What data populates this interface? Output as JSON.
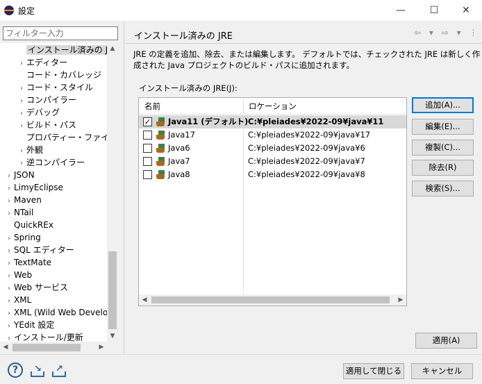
{
  "window": {
    "title": "設定",
    "minimize": "—",
    "maximize": "☐",
    "close": "✕"
  },
  "sidebar": {
    "filter_placeholder": "フィルター入力",
    "items": [
      {
        "label": "インストール済みの JRE",
        "expander": "",
        "selected": true
      },
      {
        "label": "エディター",
        "expander": "›"
      },
      {
        "label": "コード・カバレッジ",
        "expander": ""
      },
      {
        "label": "コード・スタイル",
        "expander": "›"
      },
      {
        "label": "コンパイラー",
        "expander": "›"
      },
      {
        "label": "デバッグ",
        "expander": "›"
      },
      {
        "label": "ビルド・パス",
        "expander": "›"
      },
      {
        "label": "プロパティー・ファイル・エデ",
        "expander": ""
      },
      {
        "label": "外観",
        "expander": "›"
      },
      {
        "label": "逆コンパイラー",
        "expander": "›"
      },
      {
        "label": "JSON",
        "expander": "›"
      },
      {
        "label": "LimyEclipse",
        "expander": "›"
      },
      {
        "label": "Maven",
        "expander": "›"
      },
      {
        "label": "NTail",
        "expander": "›"
      },
      {
        "label": "QuickREx",
        "expander": ""
      },
      {
        "label": "Spring",
        "expander": "›"
      },
      {
        "label": "SQL エディター",
        "expander": "›"
      },
      {
        "label": "TextMate",
        "expander": "›"
      },
      {
        "label": "Web",
        "expander": "›"
      },
      {
        "label": "Web サービス",
        "expander": "›"
      },
      {
        "label": "XML",
        "expander": "›"
      },
      {
        "label": "XML (Wild Web Develop",
        "expander": "›"
      },
      {
        "label": "YEdit 設定",
        "expander": "›"
      },
      {
        "label": "インストール/更新",
        "expander": "›"
      }
    ]
  },
  "main": {
    "title": "インストール済みの JRE",
    "nav": "⇦ ▾ ⇨ ▾ ⋮",
    "description": "JRE の定義を追加、除去、または編集します。 デフォルトでは、チェックされた JRE は新しく作成された Java プロジェクトのビルド・パスに追加されます。",
    "list_label": "インストール済みの JRE(J):",
    "columns": [
      "名前",
      "ロケーション"
    ],
    "rows": [
      {
        "name": "Java11 (デフォルト)",
        "location": "C:¥pleiades¥2022-09¥java¥11",
        "checked": true,
        "selected": true,
        "bold": true
      },
      {
        "name": "Java17",
        "location": "C:¥pleiades¥2022-09¥java¥17",
        "checked": false
      },
      {
        "name": "Java6",
        "location": "C:¥pleiades¥2022-09¥java¥6",
        "checked": false
      },
      {
        "name": "Java7",
        "location": "C:¥pleiades¥2022-09¥java¥7",
        "checked": false
      },
      {
        "name": "Java8",
        "location": "C:¥pleiades¥2022-09¥java¥8",
        "checked": false
      }
    ],
    "buttons": {
      "add": "追加(A)...",
      "edit": "編集(E)...",
      "duplicate": "複製(C)...",
      "remove": "除去(R)",
      "search": "検索(S)..."
    },
    "apply": "適用(A)"
  },
  "footer": {
    "help": "?",
    "apply_close": "適用して閉じる",
    "cancel": "キャンセル"
  },
  "colors": {
    "accent": "#0078d7",
    "selection": "#d9d9d9"
  }
}
